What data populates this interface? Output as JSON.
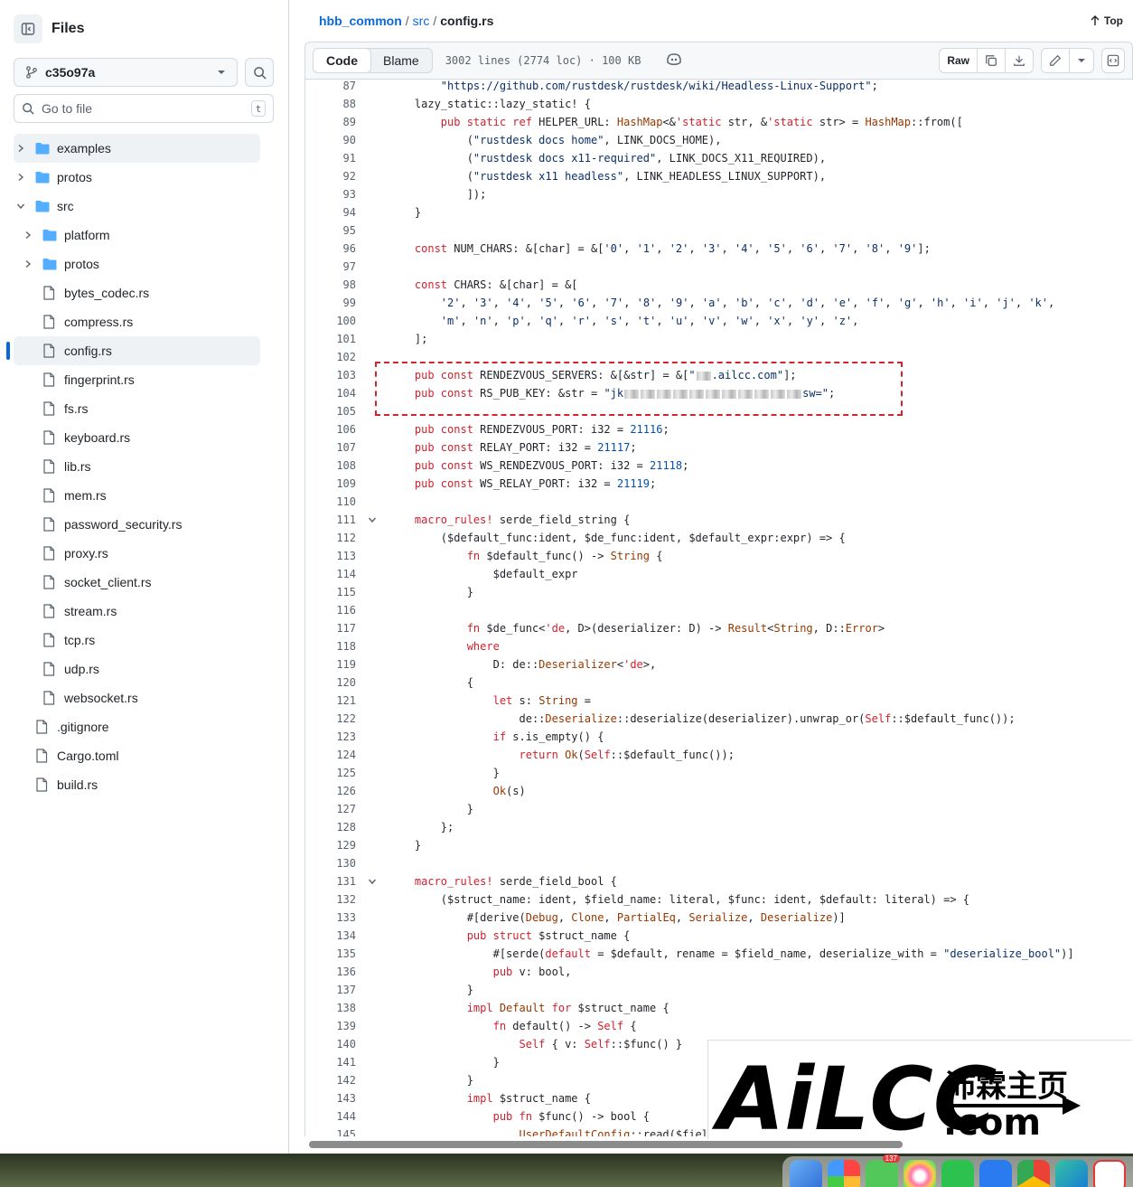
{
  "sidebar": {
    "title": "Files",
    "branch": "c35o97a",
    "goto_placeholder": "Go to file",
    "goto_shortcut": "t",
    "tree": [
      {
        "label": "examples",
        "type": "folder",
        "depth": 0,
        "expanded": false,
        "active": true
      },
      {
        "label": "protos",
        "type": "folder",
        "depth": 0,
        "expanded": false
      },
      {
        "label": "src",
        "type": "folder",
        "depth": 0,
        "expanded": true
      },
      {
        "label": "platform",
        "type": "folder",
        "depth": 1,
        "expanded": false
      },
      {
        "label": "protos",
        "type": "folder",
        "depth": 1,
        "expanded": false
      },
      {
        "label": "bytes_codec.rs",
        "type": "file",
        "depth": 1
      },
      {
        "label": "compress.rs",
        "type": "file",
        "depth": 1
      },
      {
        "label": "config.rs",
        "type": "file",
        "depth": 1,
        "selected": true
      },
      {
        "label": "fingerprint.rs",
        "type": "file",
        "depth": 1
      },
      {
        "label": "fs.rs",
        "type": "file",
        "depth": 1
      },
      {
        "label": "keyboard.rs",
        "type": "file",
        "depth": 1
      },
      {
        "label": "lib.rs",
        "type": "file",
        "depth": 1
      },
      {
        "label": "mem.rs",
        "type": "file",
        "depth": 1
      },
      {
        "label": "password_security.rs",
        "type": "file",
        "depth": 1
      },
      {
        "label": "proxy.rs",
        "type": "file",
        "depth": 1
      },
      {
        "label": "socket_client.rs",
        "type": "file",
        "depth": 1
      },
      {
        "label": "stream.rs",
        "type": "file",
        "depth": 1
      },
      {
        "label": "tcp.rs",
        "type": "file",
        "depth": 1
      },
      {
        "label": "udp.rs",
        "type": "file",
        "depth": 1
      },
      {
        "label": "websocket.rs",
        "type": "file",
        "depth": 1
      },
      {
        "label": ".gitignore",
        "type": "file",
        "depth": 0
      },
      {
        "label": "Cargo.toml",
        "type": "file",
        "depth": 0
      },
      {
        "label": "build.rs",
        "type": "file",
        "depth": 0
      }
    ]
  },
  "breadcrumb": {
    "repo": "hbb_common",
    "sep": "/",
    "dir": "src",
    "file": "config.rs",
    "top_label": "Top"
  },
  "toolbar": {
    "code_label": "Code",
    "blame_label": "Blame",
    "meta": "3002 lines (2774 loc) · 100 KB",
    "raw_label": "Raw"
  },
  "code": [
    {
      "n": "87",
      "c": [
        [
          "s",
          "        \"https://github.com/rustdesk/rustdesk/wiki/Headless-Linux-Support\""
        ],
        [
          "",
          ";"
        ]
      ]
    },
    {
      "n": "88",
      "c": [
        [
          "",
          "    lazy_static::lazy_static! {"
        ]
      ]
    },
    {
      "n": "89",
      "c": [
        [
          "k",
          "        pub static ref "
        ],
        [
          "",
          "HELPER_URL: "
        ],
        [
          "t",
          "HashMap"
        ],
        [
          "",
          "<&"
        ],
        [
          "k",
          "'static"
        ],
        [
          "",
          " str, &"
        ],
        [
          "k",
          "'static"
        ],
        [
          "",
          " str> = "
        ],
        [
          "t",
          "HashMap"
        ],
        [
          "",
          "::from(["
        ]
      ]
    },
    {
      "n": "90",
      "c": [
        [
          "",
          "            ("
        ],
        [
          "s",
          "\"rustdesk docs home\""
        ],
        [
          "",
          ", LINK_DOCS_HOME),"
        ]
      ]
    },
    {
      "n": "91",
      "c": [
        [
          "",
          "            ("
        ],
        [
          "s",
          "\"rustdesk docs x11-required\""
        ],
        [
          "",
          ", LINK_DOCS_X11_REQUIRED),"
        ]
      ]
    },
    {
      "n": "92",
      "c": [
        [
          "",
          "            ("
        ],
        [
          "s",
          "\"rustdesk x11 headless\""
        ],
        [
          "",
          ", LINK_HEADLESS_LINUX_SUPPORT),"
        ]
      ]
    },
    {
      "n": "93",
      "c": [
        [
          "",
          "            ]);"
        ]
      ]
    },
    {
      "n": "94",
      "c": [
        [
          "",
          "    }"
        ]
      ]
    },
    {
      "n": "95",
      "c": []
    },
    {
      "n": "96",
      "c": [
        [
          "k",
          "    const "
        ],
        [
          "",
          "NUM_CHARS: &[char] = &["
        ],
        [
          "s",
          "'0'"
        ],
        [
          "",
          ", "
        ],
        [
          "s",
          "'1'"
        ],
        [
          "",
          ", "
        ],
        [
          "s",
          "'2'"
        ],
        [
          "",
          ", "
        ],
        [
          "s",
          "'3'"
        ],
        [
          "",
          ", "
        ],
        [
          "s",
          "'4'"
        ],
        [
          "",
          ", "
        ],
        [
          "s",
          "'5'"
        ],
        [
          "",
          ", "
        ],
        [
          "s",
          "'6'"
        ],
        [
          "",
          ", "
        ],
        [
          "s",
          "'7'"
        ],
        [
          "",
          ", "
        ],
        [
          "s",
          "'8'"
        ],
        [
          "",
          ", "
        ],
        [
          "s",
          "'9'"
        ],
        [
          "",
          "];"
        ]
      ]
    },
    {
      "n": "97",
      "c": []
    },
    {
      "n": "98",
      "c": [
        [
          "k",
          "    const "
        ],
        [
          "",
          "CHARS: &[char] = &["
        ]
      ]
    },
    {
      "n": "99",
      "c": [
        [
          "s",
          "        '2'"
        ],
        [
          "",
          ", "
        ],
        [
          "s",
          "'3'"
        ],
        [
          "",
          ", "
        ],
        [
          "s",
          "'4'"
        ],
        [
          "",
          ", "
        ],
        [
          "s",
          "'5'"
        ],
        [
          "",
          ", "
        ],
        [
          "s",
          "'6'"
        ],
        [
          "",
          ", "
        ],
        [
          "s",
          "'7'"
        ],
        [
          "",
          ", "
        ],
        [
          "s",
          "'8'"
        ],
        [
          "",
          ", "
        ],
        [
          "s",
          "'9'"
        ],
        [
          "",
          ", "
        ],
        [
          "s",
          "'a'"
        ],
        [
          "",
          ", "
        ],
        [
          "s",
          "'b'"
        ],
        [
          "",
          ", "
        ],
        [
          "s",
          "'c'"
        ],
        [
          "",
          ", "
        ],
        [
          "s",
          "'d'"
        ],
        [
          "",
          ", "
        ],
        [
          "s",
          "'e'"
        ],
        [
          "",
          ", "
        ],
        [
          "s",
          "'f'"
        ],
        [
          "",
          ", "
        ],
        [
          "s",
          "'g'"
        ],
        [
          "",
          ", "
        ],
        [
          "s",
          "'h'"
        ],
        [
          "",
          ", "
        ],
        [
          "s",
          "'i'"
        ],
        [
          "",
          ", "
        ],
        [
          "s",
          "'j'"
        ],
        [
          "",
          ", "
        ],
        [
          "s",
          "'k'"
        ],
        [
          "",
          ","
        ]
      ]
    },
    {
      "n": "100",
      "c": [
        [
          "s",
          "        'm'"
        ],
        [
          "",
          ", "
        ],
        [
          "s",
          "'n'"
        ],
        [
          "",
          ", "
        ],
        [
          "s",
          "'p'"
        ],
        [
          "",
          ", "
        ],
        [
          "s",
          "'q'"
        ],
        [
          "",
          ", "
        ],
        [
          "s",
          "'r'"
        ],
        [
          "",
          ", "
        ],
        [
          "s",
          "'s'"
        ],
        [
          "",
          ", "
        ],
        [
          "s",
          "'t'"
        ],
        [
          "",
          ", "
        ],
        [
          "s",
          "'u'"
        ],
        [
          "",
          ", "
        ],
        [
          "s",
          "'v'"
        ],
        [
          "",
          ", "
        ],
        [
          "s",
          "'w'"
        ],
        [
          "",
          ", "
        ],
        [
          "s",
          "'x'"
        ],
        [
          "",
          ", "
        ],
        [
          "s",
          "'y'"
        ],
        [
          "",
          ", "
        ],
        [
          "s",
          "'z'"
        ],
        [
          "",
          ","
        ]
      ]
    },
    {
      "n": "101",
      "c": [
        [
          "",
          "    ];"
        ]
      ]
    },
    {
      "n": "102",
      "c": []
    },
    {
      "n": "103",
      "c": [
        [
          "k",
          "    pub const "
        ],
        [
          "",
          "RENDEZVOUS_SERVERS: &[&str] = &["
        ],
        [
          "s",
          "\""
        ],
        [
          "m",
          ""
        ],
        [
          "s",
          ".ailcc.com\""
        ],
        [
          "",
          "];"
        ]
      ]
    },
    {
      "n": "104",
      "c": [
        [
          "k",
          "    pub const "
        ],
        [
          "",
          "RS_PUB_KEY: &str = "
        ],
        [
          "s",
          "\"jk"
        ],
        [
          "m",
          ""
        ],
        [
          "m",
          ""
        ],
        [
          "m",
          ""
        ],
        [
          "m",
          ""
        ],
        [
          "m",
          ""
        ],
        [
          "m",
          ""
        ],
        [
          "m",
          ""
        ],
        [
          "m",
          ""
        ],
        [
          "m",
          ""
        ],
        [
          "m",
          ""
        ],
        [
          "m",
          ""
        ],
        [
          "s",
          "sw=\""
        ],
        [
          "",
          ";"
        ]
      ]
    },
    {
      "n": "105",
      "c": []
    },
    {
      "n": "106",
      "c": [
        [
          "k",
          "    pub const "
        ],
        [
          "",
          "RENDEZVOUS_PORT: i32 = "
        ],
        [
          "n",
          "21116"
        ],
        [
          "",
          ";"
        ]
      ]
    },
    {
      "n": "107",
      "c": [
        [
          "k",
          "    pub const "
        ],
        [
          "",
          "RELAY_PORT: i32 = "
        ],
        [
          "n",
          "21117"
        ],
        [
          "",
          ";"
        ]
      ]
    },
    {
      "n": "108",
      "c": [
        [
          "k",
          "    pub const "
        ],
        [
          "",
          "WS_RENDEZVOUS_PORT: i32 = "
        ],
        [
          "n",
          "21118"
        ],
        [
          "",
          ";"
        ]
      ]
    },
    {
      "n": "109",
      "c": [
        [
          "k",
          "    pub const "
        ],
        [
          "",
          "WS_RELAY_PORT: i32 = "
        ],
        [
          "n",
          "21119"
        ],
        [
          "",
          ";"
        ]
      ]
    },
    {
      "n": "110",
      "c": []
    },
    {
      "n": "111",
      "fold": true,
      "c": [
        [
          "k",
          "    macro_rules! "
        ],
        [
          "",
          "serde_field_string {"
        ]
      ]
    },
    {
      "n": "112",
      "c": [
        [
          "",
          "        ($default_func:ident, $de_func:ident, $default_expr:expr) => {"
        ]
      ]
    },
    {
      "n": "113",
      "c": [
        [
          "k",
          "            fn "
        ],
        [
          "",
          "$default_func() -> "
        ],
        [
          "t",
          "String"
        ],
        [
          "",
          " {"
        ]
      ]
    },
    {
      "n": "114",
      "c": [
        [
          "",
          "                $default_expr"
        ]
      ]
    },
    {
      "n": "115",
      "c": [
        [
          "",
          "            }"
        ]
      ]
    },
    {
      "n": "116",
      "c": []
    },
    {
      "n": "117",
      "c": [
        [
          "k",
          "            fn "
        ],
        [
          "",
          "$de_func<"
        ],
        [
          "k",
          "'de"
        ],
        [
          "",
          ", D>(deserializer: D) -> "
        ],
        [
          "t",
          "Result"
        ],
        [
          "",
          "<"
        ],
        [
          "t",
          "String"
        ],
        [
          "",
          ", D::"
        ],
        [
          "t",
          "Error"
        ],
        [
          "",
          ">"
        ]
      ]
    },
    {
      "n": "118",
      "c": [
        [
          "k",
          "            where"
        ]
      ]
    },
    {
      "n": "119",
      "c": [
        [
          "",
          "                D: de::"
        ],
        [
          "t",
          "Deserializer"
        ],
        [
          "",
          "<"
        ],
        [
          "k",
          "'de"
        ],
        [
          "",
          ">,"
        ]
      ]
    },
    {
      "n": "120",
      "c": [
        [
          "",
          "            {"
        ]
      ]
    },
    {
      "n": "121",
      "c": [
        [
          "k",
          "                let "
        ],
        [
          "",
          "s: "
        ],
        [
          "t",
          "String"
        ],
        [
          "",
          " ="
        ]
      ]
    },
    {
      "n": "122",
      "c": [
        [
          "",
          "                    de::"
        ],
        [
          "t",
          "Deserialize"
        ],
        [
          "",
          "::deserialize(deserializer).unwrap_or("
        ],
        [
          "k",
          "Self"
        ],
        [
          "",
          "::$default_func());"
        ]
      ]
    },
    {
      "n": "123",
      "c": [
        [
          "k",
          "                if "
        ],
        [
          "",
          "s.is_empty() {"
        ]
      ]
    },
    {
      "n": "124",
      "c": [
        [
          "k",
          "                    return "
        ],
        [
          "t",
          "Ok"
        ],
        [
          "",
          "("
        ],
        [
          "k",
          "Self"
        ],
        [
          "",
          "::$default_func());"
        ]
      ]
    },
    {
      "n": "125",
      "c": [
        [
          "",
          "                }"
        ]
      ]
    },
    {
      "n": "126",
      "c": [
        [
          "t",
          "                Ok"
        ],
        [
          "",
          "(s)"
        ]
      ]
    },
    {
      "n": "127",
      "c": [
        [
          "",
          "            }"
        ]
      ]
    },
    {
      "n": "128",
      "c": [
        [
          "",
          "        };"
        ]
      ]
    },
    {
      "n": "129",
      "c": [
        [
          "",
          "    }"
        ]
      ]
    },
    {
      "n": "130",
      "c": []
    },
    {
      "n": "131",
      "fold": true,
      "c": [
        [
          "k",
          "    macro_rules! "
        ],
        [
          "",
          "serde_field_bool {"
        ]
      ]
    },
    {
      "n": "132",
      "c": [
        [
          "",
          "        ($struct_name: ident, $field_name: literal, $func: ident, $default: literal) => {"
        ]
      ]
    },
    {
      "n": "133",
      "c": [
        [
          "",
          "            #[derive("
        ],
        [
          "t",
          "Debug"
        ],
        [
          "",
          ", "
        ],
        [
          "t",
          "Clone"
        ],
        [
          "",
          ", "
        ],
        [
          "t",
          "PartialEq"
        ],
        [
          "",
          ", "
        ],
        [
          "t",
          "Serialize"
        ],
        [
          "",
          ", "
        ],
        [
          "t",
          "Deserialize"
        ],
        [
          "",
          ")]"
        ]
      ]
    },
    {
      "n": "134",
      "c": [
        [
          "k",
          "            pub struct "
        ],
        [
          "",
          "$struct_name {"
        ]
      ]
    },
    {
      "n": "135",
      "c": [
        [
          "",
          "                #[serde("
        ],
        [
          "k",
          "default"
        ],
        [
          "",
          " = $default, rename = $field_name, deserialize_with = "
        ],
        [
          "s",
          "\"deserialize_bool\""
        ],
        [
          "",
          ")]"
        ]
      ]
    },
    {
      "n": "136",
      "c": [
        [
          "k",
          "                pub "
        ],
        [
          "",
          "v: bool,"
        ]
      ]
    },
    {
      "n": "137",
      "c": [
        [
          "",
          "            }"
        ]
      ]
    },
    {
      "n": "138",
      "c": [
        [
          "k",
          "            impl "
        ],
        [
          "t",
          "Default"
        ],
        [
          "k",
          " for "
        ],
        [
          "",
          "$struct_name {"
        ]
      ]
    },
    {
      "n": "139",
      "c": [
        [
          "k",
          "                fn "
        ],
        [
          "",
          "default() -> "
        ],
        [
          "k",
          "Self"
        ],
        [
          "",
          " {"
        ]
      ]
    },
    {
      "n": "140",
      "c": [
        [
          "k",
          "                    Self"
        ],
        [
          "",
          " { v: "
        ],
        [
          "k",
          "Self"
        ],
        [
          "",
          "::$func() }"
        ]
      ]
    },
    {
      "n": "141",
      "c": [
        [
          "",
          "                }"
        ]
      ]
    },
    {
      "n": "142",
      "c": [
        [
          "",
          "            }"
        ]
      ]
    },
    {
      "n": "143",
      "c": [
        [
          "k",
          "            impl "
        ],
        [
          "",
          "$struct_name {"
        ]
      ]
    },
    {
      "n": "144",
      "c": [
        [
          "k",
          "                pub fn "
        ],
        [
          "",
          "$func() -> bool {"
        ]
      ]
    },
    {
      "n": "145",
      "c": [
        [
          "t",
          "                    UserDefaultConfig"
        ],
        [
          "",
          "::read($field_name) == \""
        ]
      ]
    }
  ],
  "watermark": {
    "brand": "AiLCC",
    "cn": "沛霖主页",
    "domain": ".com"
  },
  "dock": {
    "messages_badge": "137"
  },
  "colors": {
    "accent": "#0969da",
    "highlight": "#d1242f"
  }
}
